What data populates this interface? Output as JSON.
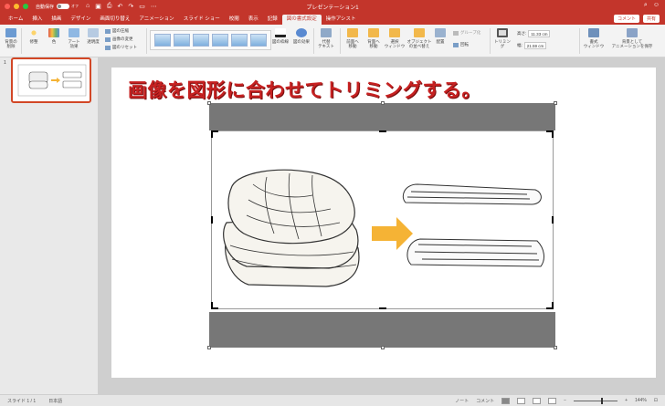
{
  "window": {
    "title": "プレゼンテーション1",
    "autosave_label": "自動保存",
    "autosave_state": "オフ"
  },
  "tabs": [
    {
      "label": "ホーム"
    },
    {
      "label": "挿入"
    },
    {
      "label": "描画"
    },
    {
      "label": "デザイン"
    },
    {
      "label": "画面切り替え"
    },
    {
      "label": "アニメーション"
    },
    {
      "label": "スライド ショー"
    },
    {
      "label": "校閲"
    },
    {
      "label": "表示"
    },
    {
      "label": "記録"
    },
    {
      "label": "図の書式設定",
      "active": true
    },
    {
      "label": "操作アシスト"
    }
  ],
  "tab_actions": {
    "comment": "コメント",
    "share": "共有"
  },
  "ribbon": {
    "remove_bg": "背景の\n削除",
    "corrections": "修整",
    "color": "色",
    "artistic": "アート\n効果",
    "transparency": "透明度",
    "compress": "図の圧縮",
    "change_picture": "画像の変更",
    "reset_picture": "図のリセット",
    "border": "図の枠線",
    "effects": "図の効果",
    "alt_text": "代替\nテキスト",
    "bring_forward": "前面へ\n移動",
    "send_backward": "背面へ\n移動",
    "selection_pane": "選択\nウィンドウ",
    "align_objects": "オブジェクト\nの並べ替え",
    "align": "配置",
    "group": "グループ化",
    "rotate": "回転",
    "crop": "トリミング",
    "height_label": "高さ:",
    "height_value": "11.33 cm",
    "width_label": "幅:",
    "width_value": "21.59 cm",
    "format_pane": "書式\nウィンドウ",
    "save_as_bg": "背景として\nアニメーションを保存"
  },
  "slide_panel": {
    "slide_number": "1"
  },
  "slide": {
    "title": "画像を図形に合わせてトリミングする。"
  },
  "status": {
    "slide_info": "スライド 1 / 1",
    "language": "日本語",
    "notes": "ノート",
    "comments": "コメント",
    "zoom": "144%"
  },
  "colors": {
    "accent": "#c3352b",
    "title_text": "#c62121",
    "crop_band": "#777777",
    "arrow": "#f5b335"
  }
}
